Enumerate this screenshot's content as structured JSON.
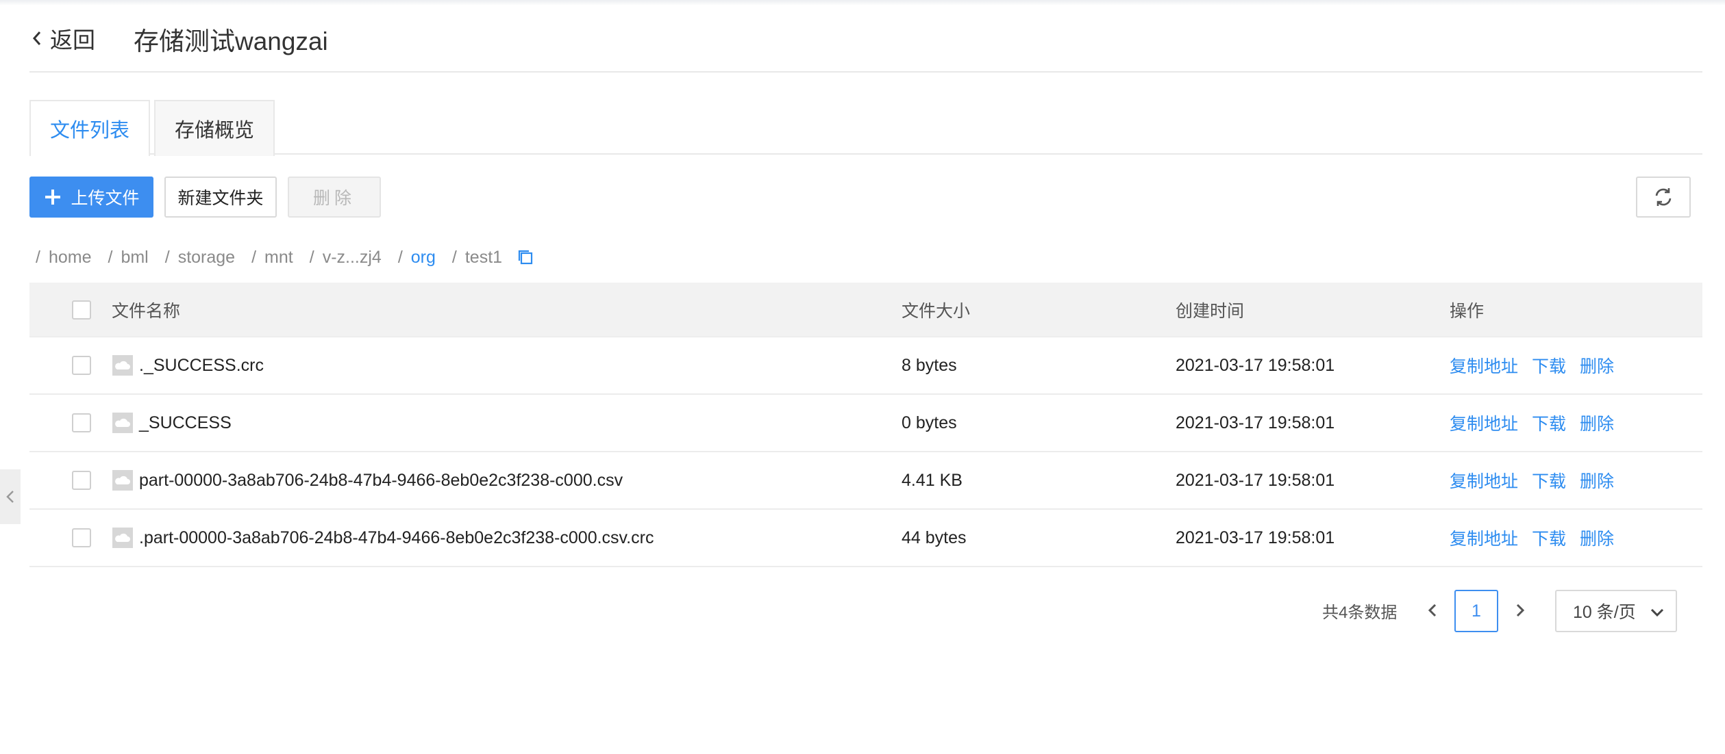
{
  "header": {
    "back_label": "返回",
    "title": "存储测试wangzai"
  },
  "tabs": [
    {
      "label": "文件列表",
      "active": true
    },
    {
      "label": "存储概览",
      "active": false
    }
  ],
  "toolbar": {
    "upload_label": "上传文件",
    "new_folder_label": "新建文件夹",
    "delete_label": "删除",
    "refresh_icon": "refresh-icon"
  },
  "breadcrumb": [
    {
      "label": "home"
    },
    {
      "label": "bml"
    },
    {
      "label": "storage"
    },
    {
      "label": "mnt"
    },
    {
      "label": "v-z...zj4"
    },
    {
      "label": "org",
      "link": true
    },
    {
      "label": "test1"
    }
  ],
  "table": {
    "columns": {
      "name": "文件名称",
      "size": "文件大小",
      "created": "创建时间",
      "ops": "操作"
    },
    "rows": [
      {
        "name": "._SUCCESS.crc",
        "size": "8 bytes",
        "created": "2021-03-17 19:58:01"
      },
      {
        "name": "_SUCCESS",
        "size": "0 bytes",
        "created": "2021-03-17 19:58:01"
      },
      {
        "name": "part-00000-3a8ab706-24b8-47b4-9466-8eb0e2c3f238-c000.csv",
        "size": "4.41 KB",
        "created": "2021-03-17 19:58:01"
      },
      {
        "name": ".part-00000-3a8ab706-24b8-47b4-9466-8eb0e2c3f238-c000.csv.crc",
        "size": "44 bytes",
        "created": "2021-03-17 19:58:01"
      }
    ],
    "ops": {
      "copy": "复制地址",
      "download": "下载",
      "delete": "删除"
    }
  },
  "pagination": {
    "total": "共4条数据",
    "current": "1",
    "page_size": "10 条/页"
  },
  "colors": {
    "primary": "#3d8ef0",
    "link": "#2d8cf0"
  }
}
